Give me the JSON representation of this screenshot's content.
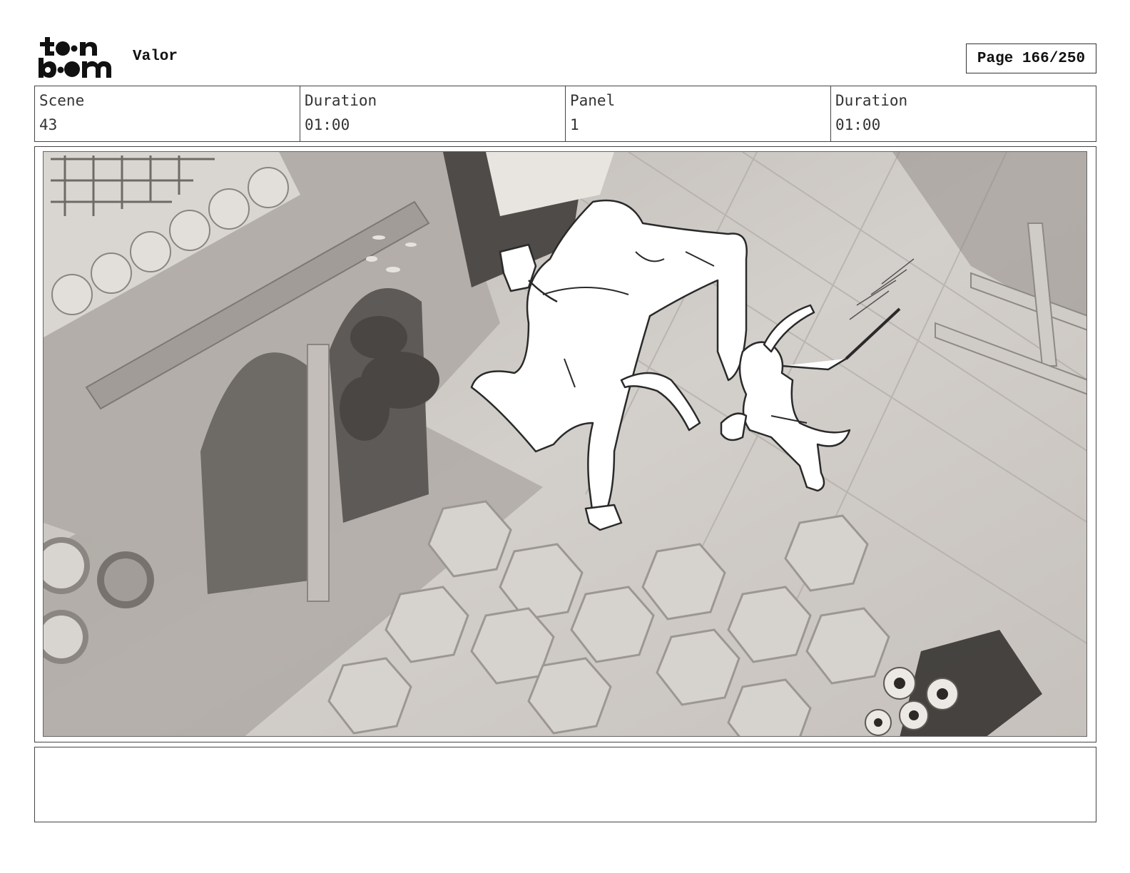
{
  "header": {
    "logo_icon": "toon-boom-logo",
    "project_title": "Valor",
    "page_label": "Page 166/250"
  },
  "info": {
    "scene_label": "Scene",
    "scene_value": "43",
    "scene_duration_label": "Duration",
    "scene_duration_value": "01:00",
    "panel_label": "Panel",
    "panel_value": "1",
    "panel_duration_label": "Duration",
    "panel_duration_value": "01:00"
  },
  "panel": {
    "image_icon": "storyboard-panel-image"
  },
  "notes": {
    "text": ""
  }
}
